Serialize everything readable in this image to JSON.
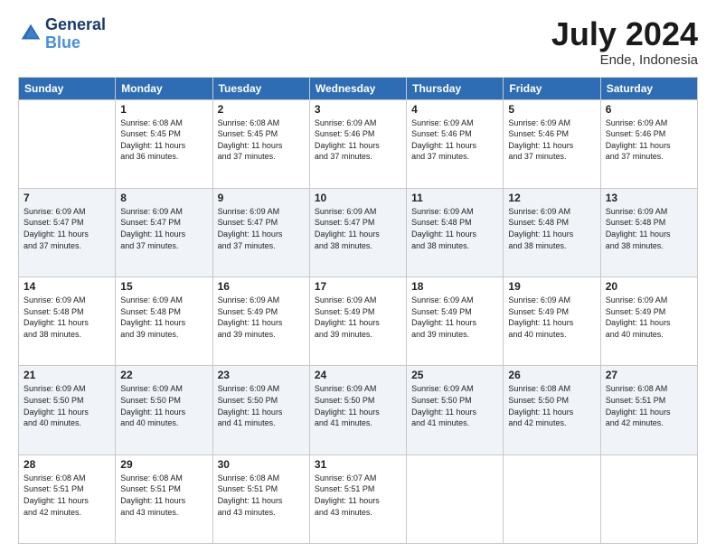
{
  "header": {
    "logo_line1": "General",
    "logo_line2": "Blue",
    "month": "July 2024",
    "location": "Ende, Indonesia"
  },
  "weekdays": [
    "Sunday",
    "Monday",
    "Tuesday",
    "Wednesday",
    "Thursday",
    "Friday",
    "Saturday"
  ],
  "weeks": [
    [
      {
        "day": "",
        "sunrise": "",
        "sunset": "",
        "daylight": ""
      },
      {
        "day": "1",
        "sunrise": "Sunrise: 6:08 AM",
        "sunset": "Sunset: 5:45 PM",
        "daylight": "Daylight: 11 hours and 36 minutes."
      },
      {
        "day": "2",
        "sunrise": "Sunrise: 6:08 AM",
        "sunset": "Sunset: 5:45 PM",
        "daylight": "Daylight: 11 hours and 37 minutes."
      },
      {
        "day": "3",
        "sunrise": "Sunrise: 6:09 AM",
        "sunset": "Sunset: 5:46 PM",
        "daylight": "Daylight: 11 hours and 37 minutes."
      },
      {
        "day": "4",
        "sunrise": "Sunrise: 6:09 AM",
        "sunset": "Sunset: 5:46 PM",
        "daylight": "Daylight: 11 hours and 37 minutes."
      },
      {
        "day": "5",
        "sunrise": "Sunrise: 6:09 AM",
        "sunset": "Sunset: 5:46 PM",
        "daylight": "Daylight: 11 hours and 37 minutes."
      },
      {
        "day": "6",
        "sunrise": "Sunrise: 6:09 AM",
        "sunset": "Sunset: 5:46 PM",
        "daylight": "Daylight: 11 hours and 37 minutes."
      }
    ],
    [
      {
        "day": "7",
        "sunrise": "Sunrise: 6:09 AM",
        "sunset": "Sunset: 5:47 PM",
        "daylight": "Daylight: 11 hours and 37 minutes."
      },
      {
        "day": "8",
        "sunrise": "Sunrise: 6:09 AM",
        "sunset": "Sunset: 5:47 PM",
        "daylight": "Daylight: 11 hours and 37 minutes."
      },
      {
        "day": "9",
        "sunrise": "Sunrise: 6:09 AM",
        "sunset": "Sunset: 5:47 PM",
        "daylight": "Daylight: 11 hours and 37 minutes."
      },
      {
        "day": "10",
        "sunrise": "Sunrise: 6:09 AM",
        "sunset": "Sunset: 5:47 PM",
        "daylight": "Daylight: 11 hours and 38 minutes."
      },
      {
        "day": "11",
        "sunrise": "Sunrise: 6:09 AM",
        "sunset": "Sunset: 5:48 PM",
        "daylight": "Daylight: 11 hours and 38 minutes."
      },
      {
        "day": "12",
        "sunrise": "Sunrise: 6:09 AM",
        "sunset": "Sunset: 5:48 PM",
        "daylight": "Daylight: 11 hours and 38 minutes."
      },
      {
        "day": "13",
        "sunrise": "Sunrise: 6:09 AM",
        "sunset": "Sunset: 5:48 PM",
        "daylight": "Daylight: 11 hours and 38 minutes."
      }
    ],
    [
      {
        "day": "14",
        "sunrise": "Sunrise: 6:09 AM",
        "sunset": "Sunset: 5:48 PM",
        "daylight": "Daylight: 11 hours and 38 minutes."
      },
      {
        "day": "15",
        "sunrise": "Sunrise: 6:09 AM",
        "sunset": "Sunset: 5:48 PM",
        "daylight": "Daylight: 11 hours and 39 minutes."
      },
      {
        "day": "16",
        "sunrise": "Sunrise: 6:09 AM",
        "sunset": "Sunset: 5:49 PM",
        "daylight": "Daylight: 11 hours and 39 minutes."
      },
      {
        "day": "17",
        "sunrise": "Sunrise: 6:09 AM",
        "sunset": "Sunset: 5:49 PM",
        "daylight": "Daylight: 11 hours and 39 minutes."
      },
      {
        "day": "18",
        "sunrise": "Sunrise: 6:09 AM",
        "sunset": "Sunset: 5:49 PM",
        "daylight": "Daylight: 11 hours and 39 minutes."
      },
      {
        "day": "19",
        "sunrise": "Sunrise: 6:09 AM",
        "sunset": "Sunset: 5:49 PM",
        "daylight": "Daylight: 11 hours and 40 minutes."
      },
      {
        "day": "20",
        "sunrise": "Sunrise: 6:09 AM",
        "sunset": "Sunset: 5:49 PM",
        "daylight": "Daylight: 11 hours and 40 minutes."
      }
    ],
    [
      {
        "day": "21",
        "sunrise": "Sunrise: 6:09 AM",
        "sunset": "Sunset: 5:50 PM",
        "daylight": "Daylight: 11 hours and 40 minutes."
      },
      {
        "day": "22",
        "sunrise": "Sunrise: 6:09 AM",
        "sunset": "Sunset: 5:50 PM",
        "daylight": "Daylight: 11 hours and 40 minutes."
      },
      {
        "day": "23",
        "sunrise": "Sunrise: 6:09 AM",
        "sunset": "Sunset: 5:50 PM",
        "daylight": "Daylight: 11 hours and 41 minutes."
      },
      {
        "day": "24",
        "sunrise": "Sunrise: 6:09 AM",
        "sunset": "Sunset: 5:50 PM",
        "daylight": "Daylight: 11 hours and 41 minutes."
      },
      {
        "day": "25",
        "sunrise": "Sunrise: 6:09 AM",
        "sunset": "Sunset: 5:50 PM",
        "daylight": "Daylight: 11 hours and 41 minutes."
      },
      {
        "day": "26",
        "sunrise": "Sunrise: 6:08 AM",
        "sunset": "Sunset: 5:50 PM",
        "daylight": "Daylight: 11 hours and 42 minutes."
      },
      {
        "day": "27",
        "sunrise": "Sunrise: 6:08 AM",
        "sunset": "Sunset: 5:51 PM",
        "daylight": "Daylight: 11 hours and 42 minutes."
      }
    ],
    [
      {
        "day": "28",
        "sunrise": "Sunrise: 6:08 AM",
        "sunset": "Sunset: 5:51 PM",
        "daylight": "Daylight: 11 hours and 42 minutes."
      },
      {
        "day": "29",
        "sunrise": "Sunrise: 6:08 AM",
        "sunset": "Sunset: 5:51 PM",
        "daylight": "Daylight: 11 hours and 43 minutes."
      },
      {
        "day": "30",
        "sunrise": "Sunrise: 6:08 AM",
        "sunset": "Sunset: 5:51 PM",
        "daylight": "Daylight: 11 hours and 43 minutes."
      },
      {
        "day": "31",
        "sunrise": "Sunrise: 6:07 AM",
        "sunset": "Sunset: 5:51 PM",
        "daylight": "Daylight: 11 hours and 43 minutes."
      },
      {
        "day": "",
        "sunrise": "",
        "sunset": "",
        "daylight": ""
      },
      {
        "day": "",
        "sunrise": "",
        "sunset": "",
        "daylight": ""
      },
      {
        "day": "",
        "sunrise": "",
        "sunset": "",
        "daylight": ""
      }
    ]
  ]
}
